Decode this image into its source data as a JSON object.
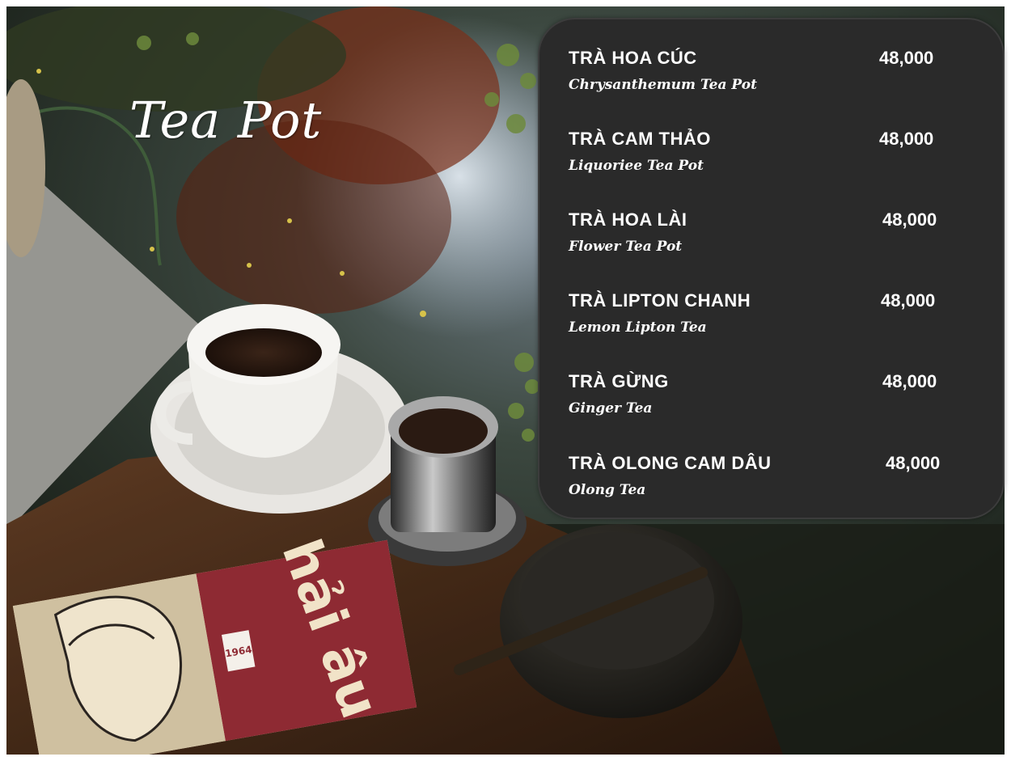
{
  "title": "Tea Pot",
  "menu": {
    "items": [
      {
        "name": "TRÀ HOA CÚC",
        "subtitle": "Chrysanthemum Tea Pot",
        "price": "48,000"
      },
      {
        "name": "TRÀ CAM THẢO",
        "subtitle": "Liquoriee Tea Pot",
        "price": "48,000"
      },
      {
        "name": "TRÀ HOA LÀI",
        "subtitle": "Flower Tea Pot",
        "price": "48,000"
      },
      {
        "name": "TRÀ LIPTON CHANH",
        "subtitle": "Lemon Lipton Tea",
        "price": "48,000"
      },
      {
        "name": "TRÀ GỪNG",
        "subtitle": "Ginger Tea",
        "price": "48,000"
      },
      {
        "name": "TRÀ OLONG CAM DÂU",
        "subtitle": "Olong Tea",
        "price": "48,000"
      }
    ]
  },
  "photo": {
    "magazine_title": "hải âu",
    "magazine_sticker": "1964"
  },
  "colors": {
    "panel": "#2a2a2a",
    "text": "#ffffff",
    "table_wood": "#4a2f1c",
    "magazine_red": "#8e2a33"
  }
}
